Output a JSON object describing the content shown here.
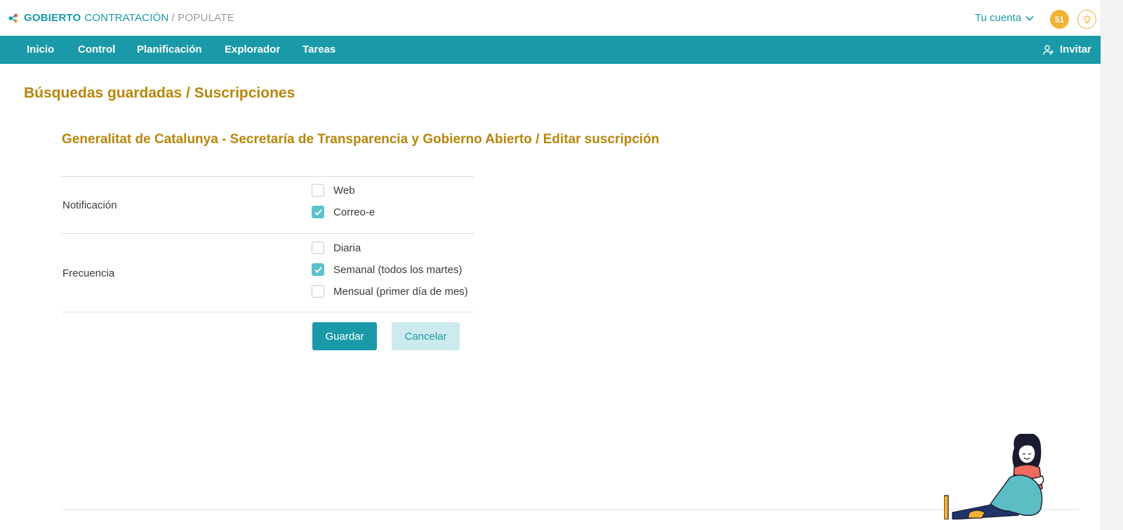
{
  "header": {
    "brand_strong": "GOBIERTO",
    "brand_light": "CONTRATACIÓN",
    "brand_sub": "/ POPULATE",
    "account_label": "Tu cuenta",
    "notifications_count": "51",
    "colors": {
      "accent": "#1a9aa8",
      "gold": "#b8860b",
      "badge": "#f2b233"
    }
  },
  "nav": {
    "items": [
      "Inicio",
      "Control",
      "Planificación",
      "Explorador",
      "Tareas"
    ],
    "invite_label": "Invitar"
  },
  "page": {
    "title": "Búsquedas guardadas / Suscripciones",
    "subtitle": "Generalitat de Catalunya - Secretaría de Transparencia y Gobierno Abierto / Editar suscripción"
  },
  "form": {
    "notification": {
      "label": "Notificación",
      "options": [
        {
          "label": "Web",
          "checked": false
        },
        {
          "label": "Correo-e",
          "checked": true
        }
      ]
    },
    "frequency": {
      "label": "Frecuencia",
      "options": [
        {
          "label": "Diaria",
          "checked": false
        },
        {
          "label": "Semanal (todos los martes)",
          "checked": true
        },
        {
          "label": "Mensual (primer día de mes)",
          "checked": false
        }
      ]
    },
    "save_label": "Guardar",
    "cancel_label": "Cancelar"
  },
  "icons": [
    "logo-icon",
    "chevron-down-icon",
    "lightbulb-icon",
    "add-user-icon",
    "check-icon",
    "woman-illustration"
  ]
}
